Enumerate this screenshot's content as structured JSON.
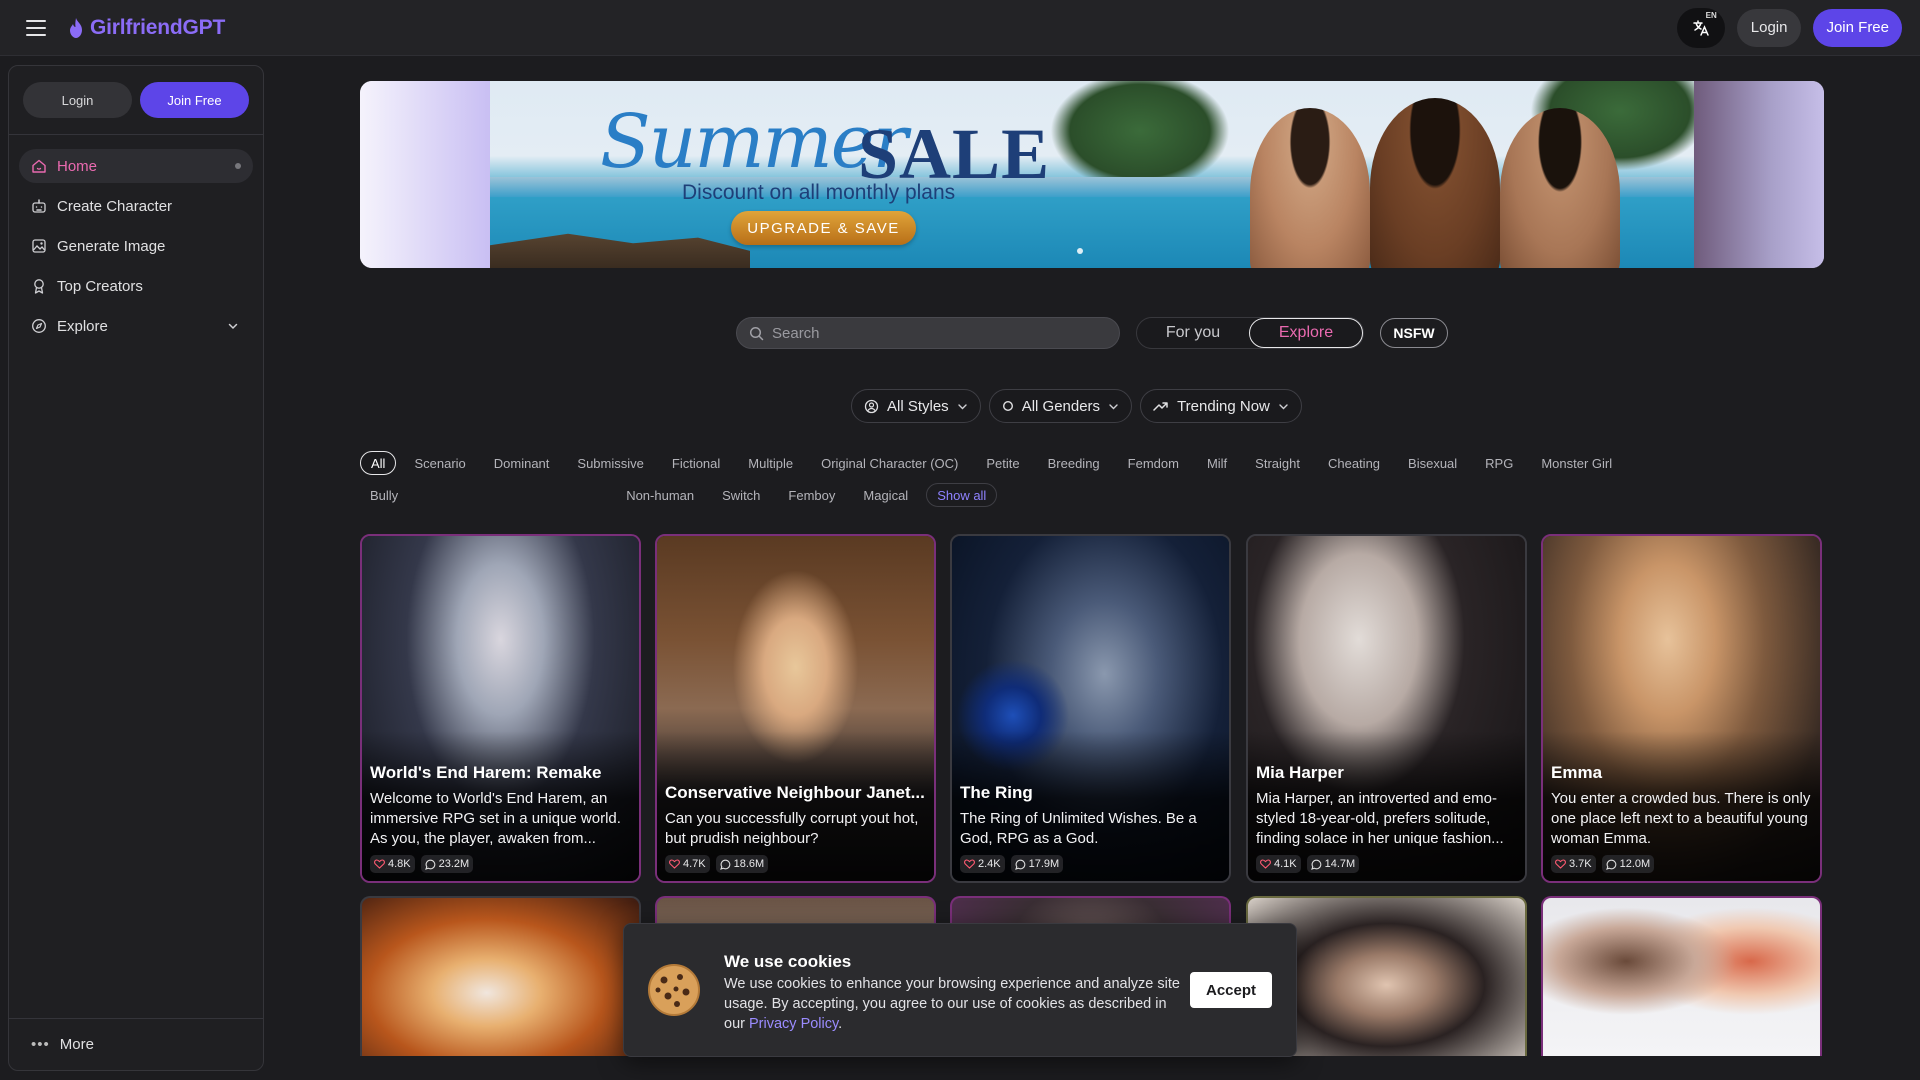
{
  "app": {
    "name": "GirlfriendGPT"
  },
  "topbar": {
    "lang_badge": "EN",
    "login_label": "Login",
    "join_label": "Join Free"
  },
  "sidebar": {
    "login_label": "Login",
    "join_label": "Join Free",
    "items": [
      {
        "label": "Home",
        "icon": "home-icon"
      },
      {
        "label": "Create Character",
        "icon": "robot-icon"
      },
      {
        "label": "Generate Image",
        "icon": "image-icon"
      },
      {
        "label": "Top Creators",
        "icon": "award-icon"
      },
      {
        "label": "Explore",
        "icon": "compass-icon"
      }
    ],
    "more_label": "More"
  },
  "banner": {
    "script_title": "Summer",
    "title": "SALE",
    "subtitle": "Discount on all monthly plans",
    "cta": "UPGRADE & SAVE"
  },
  "search": {
    "placeholder": "Search"
  },
  "feed_toggle": {
    "for_you": "For you",
    "explore": "Explore",
    "active": "Explore"
  },
  "nsfw_label": "NSFW",
  "filters": {
    "styles": "All Styles",
    "genders": "All Genders",
    "sort": "Trending Now"
  },
  "tags": {
    "active": "All",
    "items": [
      "All",
      "Scenario",
      "Dominant",
      "Submissive",
      "Fictional",
      "Multiple",
      "Original Character (OC)",
      "Petite",
      "Breeding",
      "Femdom",
      "Milf",
      "Straight",
      "Cheating",
      "Bisexual",
      "RPG",
      "Monster Girl",
      "Bully",
      "Non-human",
      "Switch",
      "Femboy",
      "Magical"
    ],
    "show_all": "Show all"
  },
  "cards": [
    {
      "title": "World's End Harem: Remake",
      "desc": "Welcome to World's End Harem, an immersive RPG set in a unique world. As you, the player, awaken from...",
      "likes": "4.8K",
      "chats": "23.2M"
    },
    {
      "title": "Conservative Neighbour Janet...",
      "desc": "Can you successfully corrupt yout hot, but prudish neighbour?",
      "likes": "4.7K",
      "chats": "18.6M"
    },
    {
      "title": "The Ring",
      "desc": "The Ring of Unlimited Wishes. Be a God, RPG as a God.",
      "likes": "2.4K",
      "chats": "17.9M"
    },
    {
      "title": "Mia Harper",
      "desc": "Mia Harper, an introverted and emo-styled 18-year-old, prefers solitude, finding solace in her unique fashion...",
      "likes": "4.1K",
      "chats": "14.7M"
    },
    {
      "title": "Emma",
      "desc": "You enter a crowded bus. There is only one place left next to a beautiful young woman Emma.",
      "likes": "3.7K",
      "chats": "12.0M"
    }
  ],
  "cookie": {
    "title": "We use cookies",
    "text": "We use cookies to enhance your browsing experience and analyze site usage. By accepting, you agree to our use of cookies as described in our ",
    "link": "Privacy Policy",
    "end": ".",
    "accept": "Accept"
  },
  "colors": {
    "accent": "#5d45e8",
    "brand": "#8b6cf6",
    "active_nav": "#ea6ab0",
    "card_border": "#7a2f7a"
  }
}
